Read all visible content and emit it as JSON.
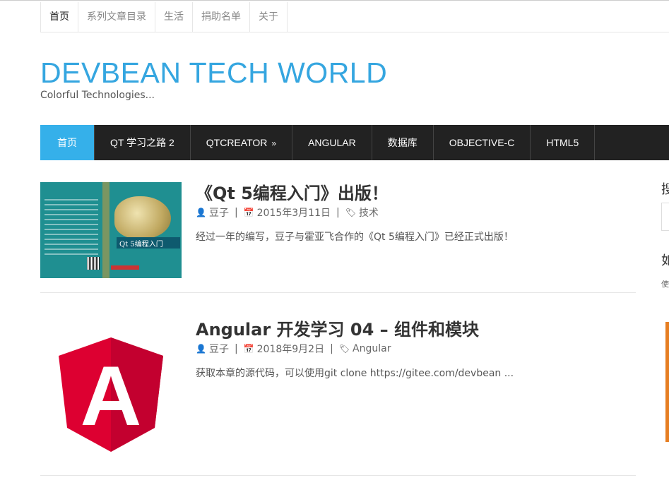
{
  "topnav": {
    "items": [
      "首页",
      "系列文章目录",
      "生活",
      "捐助名单",
      "关于"
    ]
  },
  "site": {
    "title": "DEVBEAN TECH WORLD",
    "tagline": "Colorful Technologies..."
  },
  "mainnav": {
    "items": [
      "首页",
      "QT 学习之路 2",
      "QTCREATOR",
      "ANGULAR",
      "数据库",
      "OBJECTIVE-C",
      "HTML5"
    ],
    "submenu_arrow": "»"
  },
  "posts": [
    {
      "title": "《Qt 5编程入门》出版！",
      "author": "豆子",
      "date": "2015年3月11日",
      "category": "技术",
      "excerpt": "经过一年的编写，豆子与霍亚飞合作的《Qt 5编程入门》已经正式出版！",
      "cover_text": "Qt 5编程入门"
    },
    {
      "title": "Angular 开发学习 04 – 组件和模块",
      "author": "豆子",
      "date": "2018年9月2日",
      "category": "Angular",
      "excerpt": "获取本章的源代码，可以使用git clone https://gitee.com/devbean ...",
      "logo_letter": "A"
    }
  ],
  "meta_separator": "|",
  "sidebar": {
    "heading1": "搜",
    "heading2": "如",
    "small": "使"
  },
  "colors": {
    "accent": "#35a6e0",
    "nav_bg": "#222222",
    "nav_active": "#35b0ea",
    "angular_red": "#dd0031",
    "angular_dark": "#c3002f"
  },
  "icons": {
    "author": "user-icon",
    "date": "calendar-icon",
    "category": "tags-icon"
  }
}
